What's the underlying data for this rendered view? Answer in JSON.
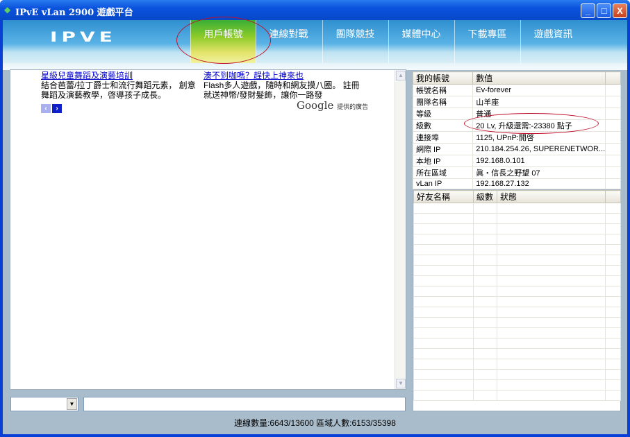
{
  "window": {
    "title": "IPvE vLan 2900 遊戲平台",
    "minimize": "_",
    "maximize": "□",
    "close": "X"
  },
  "logo": "IPVE",
  "tabs": [
    "用戶帳號",
    "連線對戰",
    "團隊競技",
    "媒體中心",
    "下載專區",
    "遊戲資訊"
  ],
  "ads": [
    {
      "title": "星級兒童舞蹈及演藝培訓",
      "body": "結合芭蕾/拉丁爵士和流行舞蹈元素， 創意舞蹈及演藝教學，啓導孩子成長。"
    },
    {
      "title": "湊不到咖嗎？趕快上神來也",
      "body": "Flash多人遊戲，隨時和網友摸八圈。 註冊就送神幣/發財髮飾，讓你一路發"
    }
  ],
  "ad_nav": {
    "prev": "‹",
    "next": "›"
  },
  "google": {
    "brand": "Google",
    "label": "提供的廣告"
  },
  "account": {
    "headers": [
      "我的帳號",
      "數值"
    ],
    "rows": [
      [
        "帳號名稱",
        "Ev-forever"
      ],
      [
        "團隊名稱",
        "山羊座"
      ],
      [
        "等級",
        "普通"
      ],
      [
        "級數",
        "20 Lv, 升級還需:-23380 點子"
      ],
      [
        "連接埠",
        "1125, UPnP:開啓"
      ],
      [
        "網際 IP",
        "210.184.254.26, SUPERENETWOR..."
      ],
      [
        "本地 IP",
        "192.168.0.101"
      ],
      [
        "所在區域",
        "眞・信長之野望 07"
      ],
      [
        "vLan IP",
        "192.168.27.132"
      ]
    ]
  },
  "friends": {
    "headers": [
      "好友名稱",
      "級數",
      "狀態"
    ]
  },
  "status": "連線數量:6643/13600    區域人數:6153/35398"
}
